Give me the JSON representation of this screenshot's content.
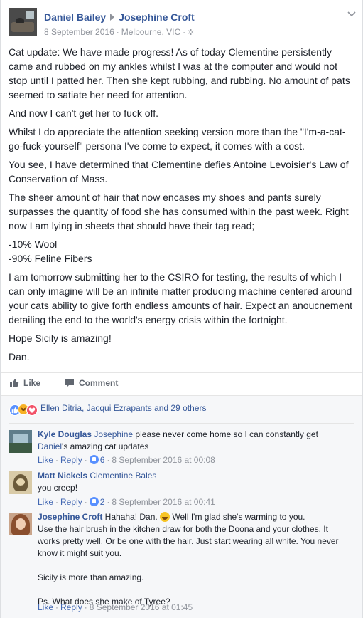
{
  "header": {
    "author": "Daniel Bailey",
    "target": "Josephine Croft",
    "date": "8 September 2016",
    "location": "Melbourne, VIC"
  },
  "post": {
    "paragraphs": [
      "Cat update: We have made progress! As of today Clementine persistently came and rubbed on my ankles whilst I was at the computer and would not stop until I patted her. Then she kept rubbing, and rubbing. No amount of pats seemed to satiate her need for attention.",
      "And now I can't get her to fuck off.",
      "Whilst I do appreciate the attention seeking version more than the \"I'm-a-cat-go-fuck-yourself\" persona I've come to expect, it comes with a cost.",
      "You see, I have determined that Clementine defies Antoine Levoisier's Law of Conservation of Mass.",
      "The sheer amount of hair that now encases my shoes and pants surely surpasses the quantity of food she has consumed within the past week. Right now I am lying in sheets that should have their tag read;"
    ],
    "list": [
      "-10% Wool",
      "-90% Feline Fibers"
    ],
    "paragraphs2": [
      "I am tomorrow submitting her to the CSIRO for testing, the results of which I can only imagine will be an infinite matter producing machine centered around your cats ability to give forth endless amounts of hair. Expect an anoucnement detailing the end to the world's energy crisis within the fortnight.",
      "Hope Sicily is amazing!",
      "Dan."
    ]
  },
  "actions": {
    "like": "Like",
    "comment": "Comment"
  },
  "reactions": {
    "summary": "Ellen Ditria, Jacqui Ezrapants and 29 others"
  },
  "comments": [
    {
      "name": "Kyle Douglas",
      "tag": "Josephine",
      "text_a": " please never come home so I can constantly get ",
      "tag2": "Daniel",
      "text_b": "'s amazing cat updates",
      "like": "Like",
      "reply": "Reply",
      "count": "6",
      "date": "8 September 2016 at 00:08"
    },
    {
      "name": "Matt Nickels",
      "tag": "Clementine Bales",
      "text": "you creep!",
      "like": "Like",
      "reply": "Reply",
      "count": "2",
      "date": "8 September 2016 at 00:41"
    },
    {
      "name": "Josephine Croft",
      "text_a": " Hahaha! Dan. ",
      "text_b": " Well I'm glad she's warming to you.",
      "line2": "Use the hair brush in the kitchen draw for both the Doona and your clothes. It works pretty well. Or be one with the hair. Just start wearing all white. You never know it might suit you.",
      "line3": "Sicily is more than amazing.",
      "line4": "Ps. What does she make of Tyree?",
      "like": "Like",
      "reply": "Reply",
      "date": "8 September 2016 at 01:45"
    }
  ]
}
